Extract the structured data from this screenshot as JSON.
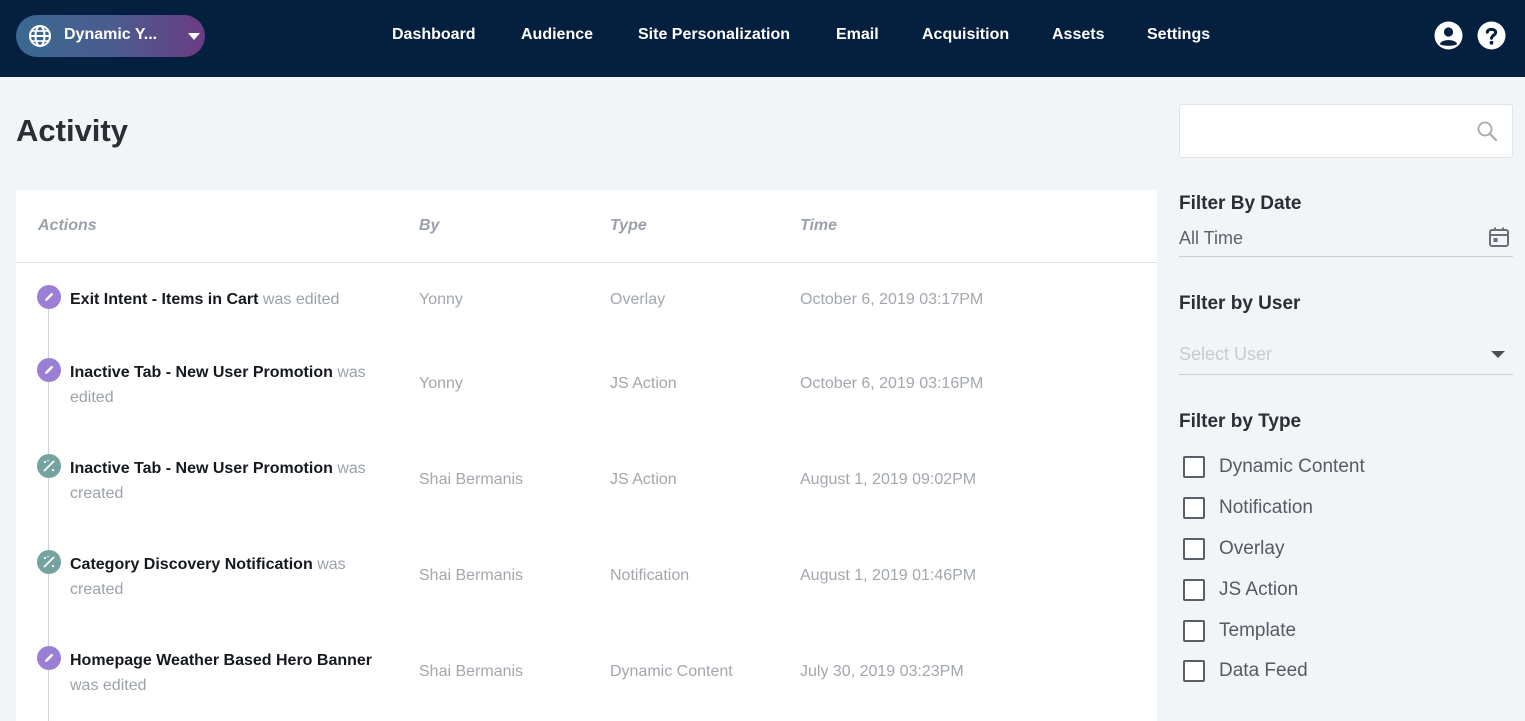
{
  "header": {
    "site_name": "Dynamic Y...",
    "nav": [
      "Dashboard",
      "Audience",
      "Site Personalization",
      "Email",
      "Acquisition",
      "Assets",
      "Settings"
    ],
    "icons": [
      "globe-icon",
      "chevron-down-icon",
      "user-icon",
      "help-icon"
    ]
  },
  "page": {
    "title": "Activity"
  },
  "table": {
    "columns": [
      "Actions",
      "By",
      "Type",
      "Time"
    ],
    "rows": [
      {
        "kind": "edit",
        "name": "Exit Intent - Items in Cart",
        "verb": "was edited",
        "by": "Yonny",
        "type": "Overlay",
        "time": "October 6, 2019 03:17PM"
      },
      {
        "kind": "edit",
        "name": "Inactive Tab - New User Promotion",
        "verb": "was edited",
        "by": "Yonny",
        "type": "JS Action",
        "time": "October 6, 2019 03:16PM"
      },
      {
        "kind": "create",
        "name": "Inactive Tab - New User Promotion",
        "verb": "was created",
        "by": "Shai Bermanis",
        "type": "JS Action",
        "time": "August 1, 2019 09:02PM"
      },
      {
        "kind": "create",
        "name": "Category Discovery Notification",
        "verb": "was created",
        "by": "Shai Bermanis",
        "type": "Notification",
        "time": "August 1, 2019 01:46PM"
      },
      {
        "kind": "edit",
        "name": "Homepage Weather Based Hero Banner",
        "verb": "was edited",
        "by": "Shai Bermanis",
        "type": "Dynamic Content",
        "time": "July 30, 2019 03:23PM"
      }
    ]
  },
  "sidebar": {
    "search_placeholder": "",
    "filter_date_label": "Filter By Date",
    "filter_date_value": "All Time",
    "filter_user_label": "Filter by User",
    "filter_user_placeholder": "Select User",
    "filter_type_label": "Filter by Type",
    "types": [
      {
        "label": "Dynamic Content",
        "checked": false
      },
      {
        "label": "Notification",
        "checked": false
      },
      {
        "label": "Overlay",
        "checked": false
      },
      {
        "label": "JS Action",
        "checked": false
      },
      {
        "label": "Template",
        "checked": false
      },
      {
        "label": "Data Feed",
        "checked": false
      }
    ]
  },
  "colors": {
    "header_bg": "#051f3f",
    "edit_icon": "#9b7fd4",
    "create_icon": "#74a3a0"
  }
}
